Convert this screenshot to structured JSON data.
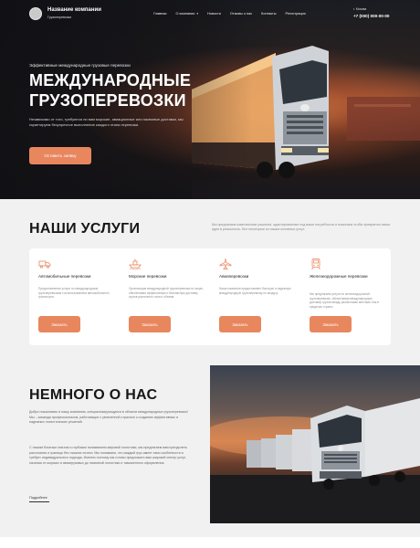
{
  "header": {
    "company_name": "Название компании",
    "company_sub": "Грузоперевозки",
    "nav": [
      {
        "label": "Главная"
      },
      {
        "label": "О компании"
      },
      {
        "label": "Новости"
      },
      {
        "label": "Отзывы о нас"
      },
      {
        "label": "Контакты"
      },
      {
        "label": "Регистрация"
      }
    ],
    "city": "г. Москва",
    "phone": "+7 (000) 000-00-00"
  },
  "hero": {
    "kicker": "Эффективные международные грузовые перевозки",
    "title_line1": "МЕЖДУНАРОДНЫЕ",
    "title_line2": "ГРУЗОПЕРЕВОЗКИ",
    "description": "Независимо от того, требуются ли вам морские, авиационные или наземные доставки, мы гарантируем безупречное выполнение каждого этапа перевозки.",
    "cta": "Оставить заявку"
  },
  "services": {
    "title": "НАШИ УСЛУГИ",
    "intro": "Мы предлагаем комплексные решения, адаптированные под ваши потребности и помогаем чтобы превратить ваши идеи в реальность. Вот некоторые из наших основных услуг:",
    "items": [
      {
        "title": "Автомобильные перевозки",
        "desc": "Предоставление услуги по международным грузоперевозкам с использованием автомобильного транспорта",
        "button": "Заказать",
        "icon": "truck-icon"
      },
      {
        "title": "Морские перевозки",
        "desc": "Организация международной грузоперевозки по морю, обеспечивая эффективную и безопасную доставку грузов различного типа и объема",
        "button": "Заказать",
        "icon": "ship-icon"
      },
      {
        "title": "Авиаперевозки",
        "desc": "Наша компания предоставляет быструю и надежную международную грузоперевозку по воздуху",
        "button": "Заказать",
        "icon": "airplane-icon"
      },
      {
        "title": "Железнодорожные перевозки",
        "desc": "Мы предлагаем услуги по железнодорожной грузоперевозке, обеспечивая международную доставку грузов между различными местами. Как в пределах страны",
        "button": "Заказать",
        "icon": "train-icon"
      }
    ]
  },
  "about": {
    "title": "НЕМНОГО О НАС",
    "p1": "Добро пожаловать в нашу компанию, специализирующуюся в области международных грузоперевозок! Мы – команда профессионалов, работающих с увлеченной страстью к созданию эффективных и надежных логистических решений.",
    "p2": "С нашим богатым опытом и глубоким пониманием мировой логистики, мы предлагаем вам преодолеть расстояния и границы без лишних хлопот. Мы понимаем, что каждый груз имеет свои особенности и требует индивидуального подхода. Именно поэтому мы готовы предложить вам широкий спектр услуг, начиная от морских и авиагрузовых до наземной логистики и таможенного оформления.",
    "more": "Подробнее"
  },
  "colors": {
    "accent": "#e8865e",
    "dark": "#161616",
    "bg": "#f1f1f1"
  }
}
